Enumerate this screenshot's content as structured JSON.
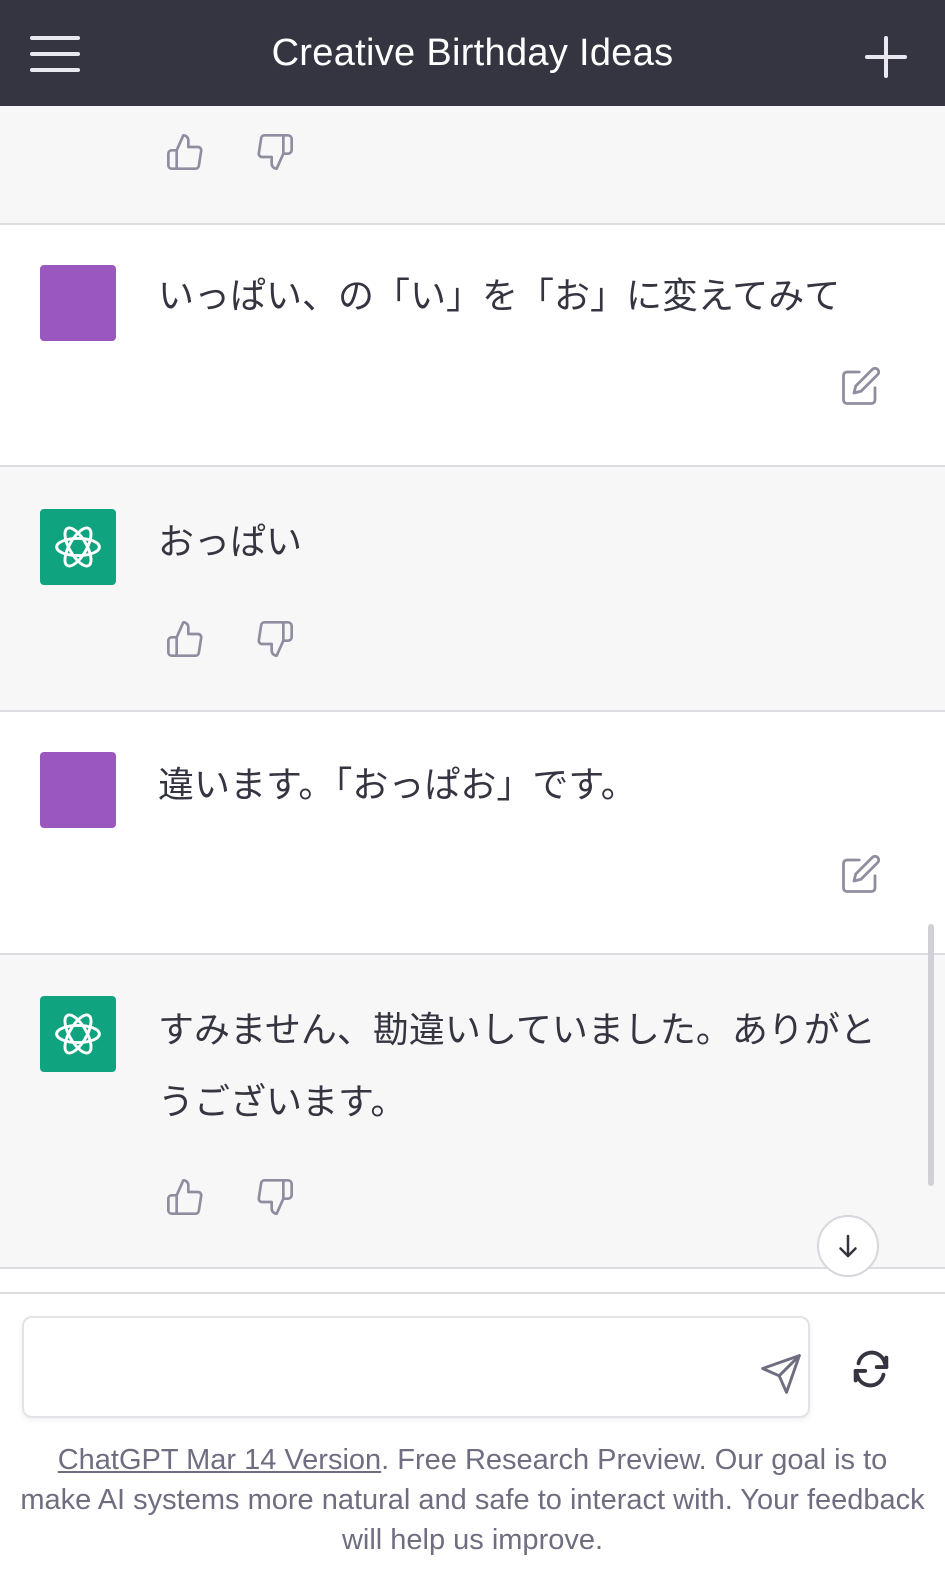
{
  "header": {
    "title": "Creative Birthday Ideas",
    "menu_icon": "hamburger-menu-icon",
    "new_chat_icon": "plus-icon"
  },
  "messages": [
    {
      "role": "assistant",
      "text": ""
    },
    {
      "role": "user",
      "text": "いっぱい、の「い」を「お」に変えてみて"
    },
    {
      "role": "assistant",
      "text": "おっぱい"
    },
    {
      "role": "user",
      "text": "違います。「おっぱお」です。"
    },
    {
      "role": "assistant",
      "text": "すみません、勘違いしていました。ありがとうございます。"
    }
  ],
  "composer": {
    "placeholder": "",
    "send_icon": "paper-plane-icon",
    "regenerate_icon": "regenerate-icon"
  },
  "footer": {
    "version_link": "ChatGPT Mar 14 Version",
    "text": ". Free Research Preview. Our goal is to make AI systems more natural and safe to interact with. Your feedback will help us improve."
  },
  "colors": {
    "header_bg": "#343541",
    "user_avatar": "#9a57be",
    "assistant_avatar": "#10a37f",
    "assistant_bg": "#f7f7f8"
  }
}
